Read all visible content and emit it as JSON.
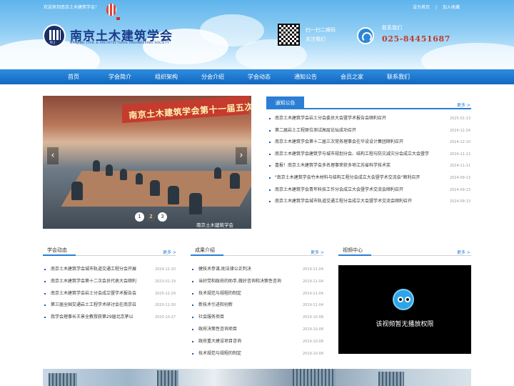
{
  "header": {
    "welcome": "欢迎来到南京土木建筑学会！",
    "top_links": [
      "设为首页",
      "|",
      "加入收藏"
    ],
    "site_name": "南京土木建筑学会",
    "site_name_en": "NANJING CIVIL & ARCHITECTURAL ENGINEERING SOCIETY",
    "logo_text": "N J",
    "qr_label_1": "扫一扫二维码",
    "qr_label_2": "关注我们",
    "contact_label": "联系我们",
    "contact_phone": "025-84451687"
  },
  "nav": {
    "items": [
      "首页",
      "学会简介",
      "组织架构",
      "分会介绍",
      "学会动态",
      "通知公告",
      "会员之家",
      "联系我们"
    ]
  },
  "slideshow": {
    "banner_text": "南京土木建筑学会第十一届五次常务理事会议",
    "dots": [
      "1",
      "2",
      "3"
    ],
    "active_dot": 2,
    "watermark": "南京土木建筑学会",
    "prev": "‹",
    "next": "›"
  },
  "notice": {
    "title": "通知公告",
    "more": "更多 >",
    "items": [
      {
        "title": "南京土木建筑学会岩土分会委员大会暨学术报告会顺利召开",
        "date": "2025-01-13"
      },
      {
        "title": "第二届岩土工程原位测试高层论坛成功召开",
        "date": "2024-12-24"
      },
      {
        "title": "南京土木建筑学会第十二届三次常务理事会在华设设计集团顺利召开",
        "date": "2024-12-10"
      },
      {
        "title": "南京土木建筑学会建筑学与城市规划分会、结构工程与防灾减灾分会成立大会暨学",
        "date": "2024-11-12"
      },
      {
        "title": "喜报！南京土木建筑学会多名理事荣获多项江苏省科学技术奖",
        "date": "2024-11-11"
      },
      {
        "title": "\"南京土木建筑学会竹木材料与结构工程分会成立大会暨学术交流会\"顺利召开",
        "date": "2024-09-13"
      },
      {
        "title": "南京土木建筑学会青年科技工作分会成立大会暨学术交流会顺利召开",
        "date": "2024-09-13"
      },
      {
        "title": "南京土木建筑学会城市轨道交通工程分会成立大会暨学术交流会顺利召开",
        "date": "2024-09-13"
      }
    ]
  },
  "news": {
    "title": "学会动态",
    "more": "更多 >",
    "items": [
      {
        "title": "南京土木建筑学会城市轨道交通工程分会开展",
        "date": "2024-12-10"
      },
      {
        "title": "南京土木建筑学会第十二次会员代表大会顺利",
        "date": "2023-01-19"
      },
      {
        "title": "南京土木建筑学会岩土分会成立暨学术报告会",
        "date": "2020-12-29"
      },
      {
        "title": "第三届全国交通岩土工程学术研讨会在南京召",
        "date": "2020-11-30"
      },
      {
        "title": "我学会理事长王景全教授获第29届北京茅以",
        "date": "2020-10-27"
      }
    ]
  },
  "results": {
    "title": "成果介绍",
    "more": "更多 >",
    "items": [
      {
        "title": "健技术参谋,助法律公正判决",
        "date": "2019-11-04"
      },
      {
        "title": "当好党和政府的助手,做好咨询和决策性咨询",
        "date": "2019-11-04"
      },
      {
        "title": "技术规范与规程的制定",
        "date": "2019-11-04"
      },
      {
        "title": "新技术引进和创新",
        "date": "2019-11-04"
      },
      {
        "title": "社会服务项目",
        "date": "2019-10-08"
      },
      {
        "title": "政府决策性咨询项目",
        "date": "2019-10-08"
      },
      {
        "title": "政府重大建设项目咨询",
        "date": "2019-10-08"
      },
      {
        "title": "技术规范与规程的制定",
        "date": "2019-10-08"
      }
    ]
  },
  "video": {
    "title": "视频中心",
    "more": "更多 >",
    "message": "该视频暂无播放权限"
  }
}
